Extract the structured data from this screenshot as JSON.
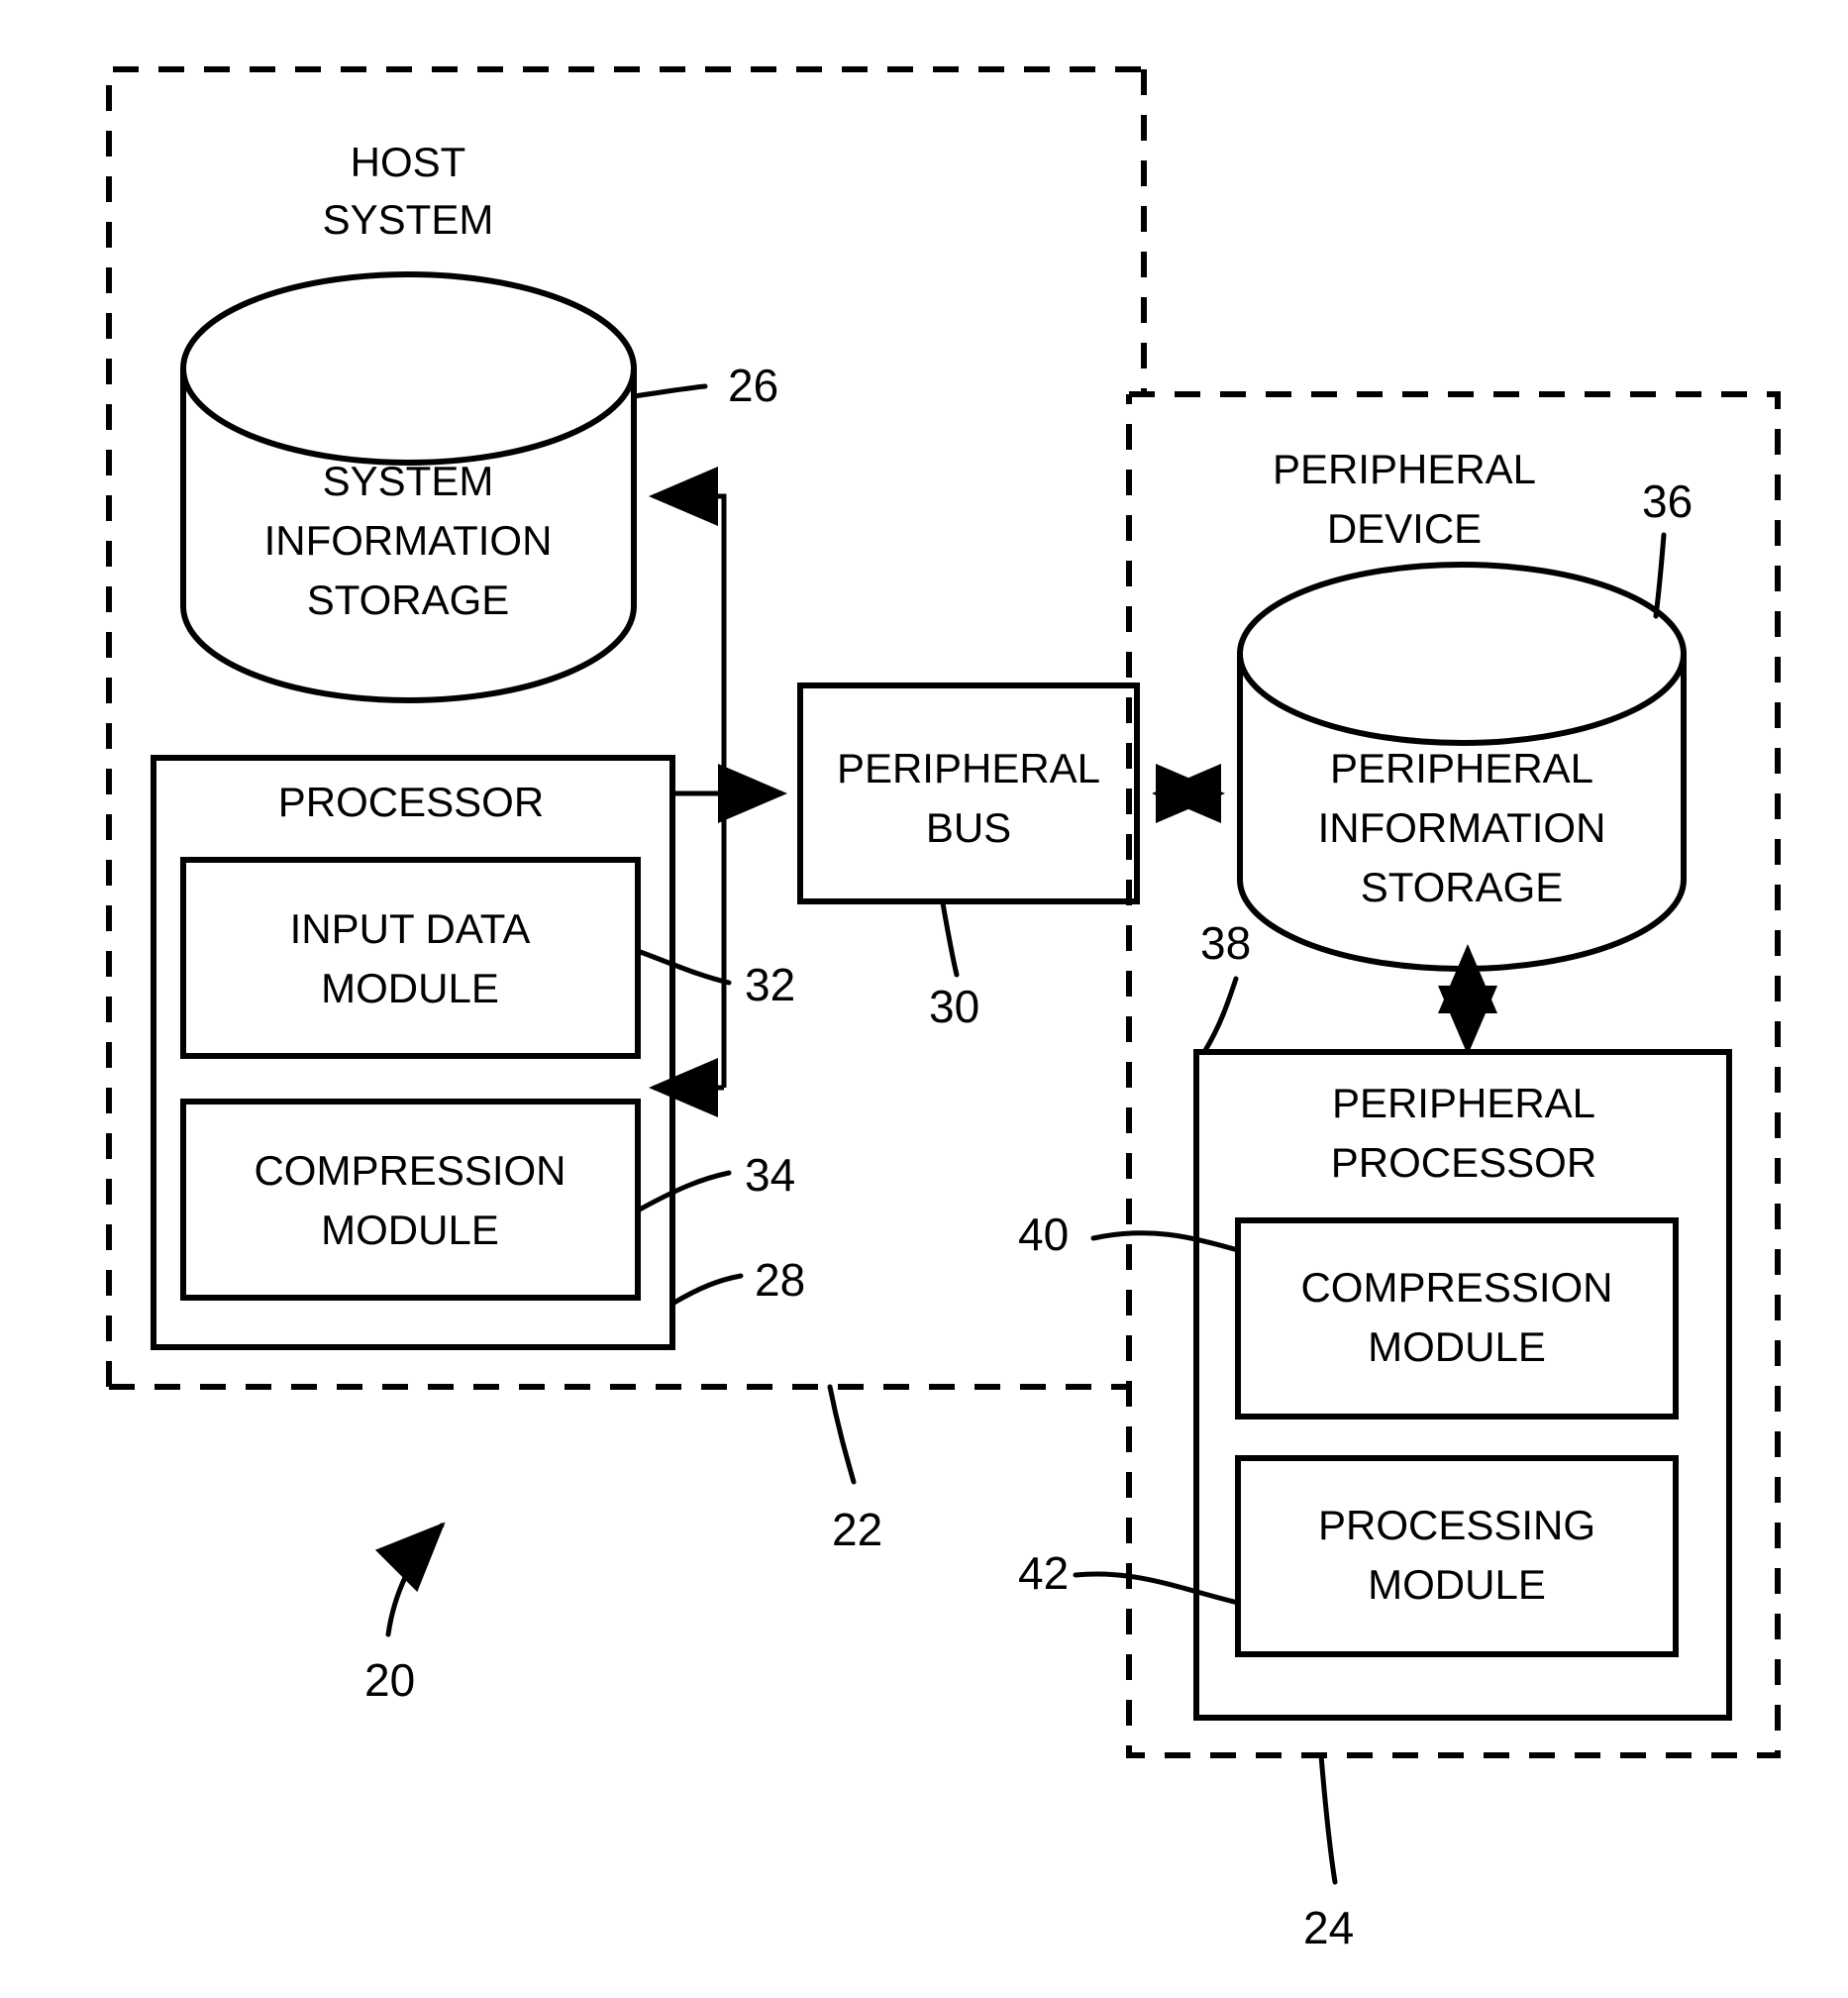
{
  "figure": {
    "type": "patent-block-diagram",
    "background_color": "#ffffff",
    "line_color": "#000000"
  },
  "host_system": {
    "title_line1": "HOST",
    "title_line2": "SYSTEM",
    "boundary_ref": "22",
    "storage": {
      "line1": "SYSTEM",
      "line2": "INFORMATION",
      "line3": "STORAGE",
      "ref": "26"
    },
    "processor": {
      "label": "PROCESSOR",
      "ref": "28",
      "modules": [
        {
          "line1": "INPUT DATA",
          "line2": "MODULE",
          "ref": "32"
        },
        {
          "line1": "COMPRESSION",
          "line2": "MODULE",
          "ref": "34"
        }
      ]
    }
  },
  "peripheral_bus": {
    "line1": "PERIPHERAL",
    "line2": "BUS",
    "ref": "30"
  },
  "peripheral_device": {
    "title_line1": "PERIPHERAL",
    "title_line2": "DEVICE",
    "boundary_ref": "24",
    "storage": {
      "line1": "PERIPHERAL",
      "line2": "INFORMATION",
      "line3": "STORAGE",
      "ref": "36"
    },
    "processor": {
      "line1": "PERIPHERAL",
      "line2": "PROCESSOR",
      "ref": "38",
      "modules": [
        {
          "line1": "COMPRESSION",
          "line2": "MODULE",
          "ref": "40"
        },
        {
          "line1": "PROCESSING",
          "line2": "MODULE",
          "ref": "42"
        }
      ]
    }
  },
  "system_ref": "20",
  "refs": {
    "r20": "20",
    "r22": "22",
    "r24": "24",
    "r26": "26",
    "r28": "28",
    "r30": "30",
    "r32": "32",
    "r34": "34",
    "r36": "36",
    "r38": "38",
    "r40": "40",
    "r42": "42"
  }
}
